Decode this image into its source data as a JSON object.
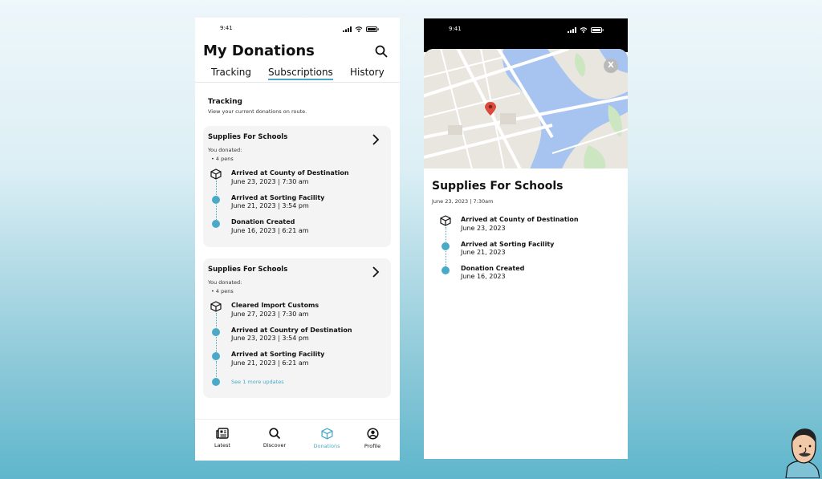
{
  "status": {
    "time": "9:41"
  },
  "header": {
    "title": "My Donations"
  },
  "tabs": [
    {
      "label": "Tracking"
    },
    {
      "label": "Subscriptions"
    },
    {
      "label": "History"
    }
  ],
  "section": {
    "title": "Tracking",
    "subtitle": "View your current donations on route."
  },
  "cards": [
    {
      "title": "Supplies For Schools",
      "donated_label": "You donated:",
      "items": [
        "4 pens"
      ],
      "events": [
        {
          "title": "Arrived at County of Destination",
          "date": "June 23, 2023 | 7:30 am"
        },
        {
          "title": "Arrived at Sorting Facility",
          "date": "June 21, 2023 | 3:54 pm"
        },
        {
          "title": "Donation Created",
          "date": "June 16, 2023 | 6:21 am"
        }
      ]
    },
    {
      "title": "Supplies For Schools",
      "donated_label": "You donated:",
      "items": [
        "4 pens"
      ],
      "events": [
        {
          "title": "Cleared Import Customs",
          "date": "June 27, 2023 | 7:30 am"
        },
        {
          "title": "Arrived at Country of Destination",
          "date": "June 23, 2023 | 3:54 pm"
        },
        {
          "title": "Arrived at Sorting Facility",
          "date": "June 21, 2023 | 6:21 am"
        }
      ],
      "more_link": "See 1 more updates"
    }
  ],
  "nav": [
    {
      "label": "Latest",
      "icon": "newspaper-icon"
    },
    {
      "label": "Discover",
      "icon": "search-icon"
    },
    {
      "label": "Donations",
      "icon": "box-icon",
      "active": true
    },
    {
      "label": "Profile",
      "icon": "profile-icon"
    }
  ],
  "detail": {
    "close_label": "X",
    "title": "Supplies For Schools",
    "subtitle": "June 23, 2023 | 7:30am",
    "events": [
      {
        "title": "Arrived at County of Destination",
        "date": "June 23, 2023"
      },
      {
        "title": "Arrived at Sorting Facility",
        "date": "June 21, 2023"
      },
      {
        "title": "Donation Created",
        "date": "June 16, 2023"
      }
    ]
  },
  "colors": {
    "accent": "#4aa9c7",
    "card_bg": "#f4f4f4",
    "water": "#a7c4f0"
  }
}
